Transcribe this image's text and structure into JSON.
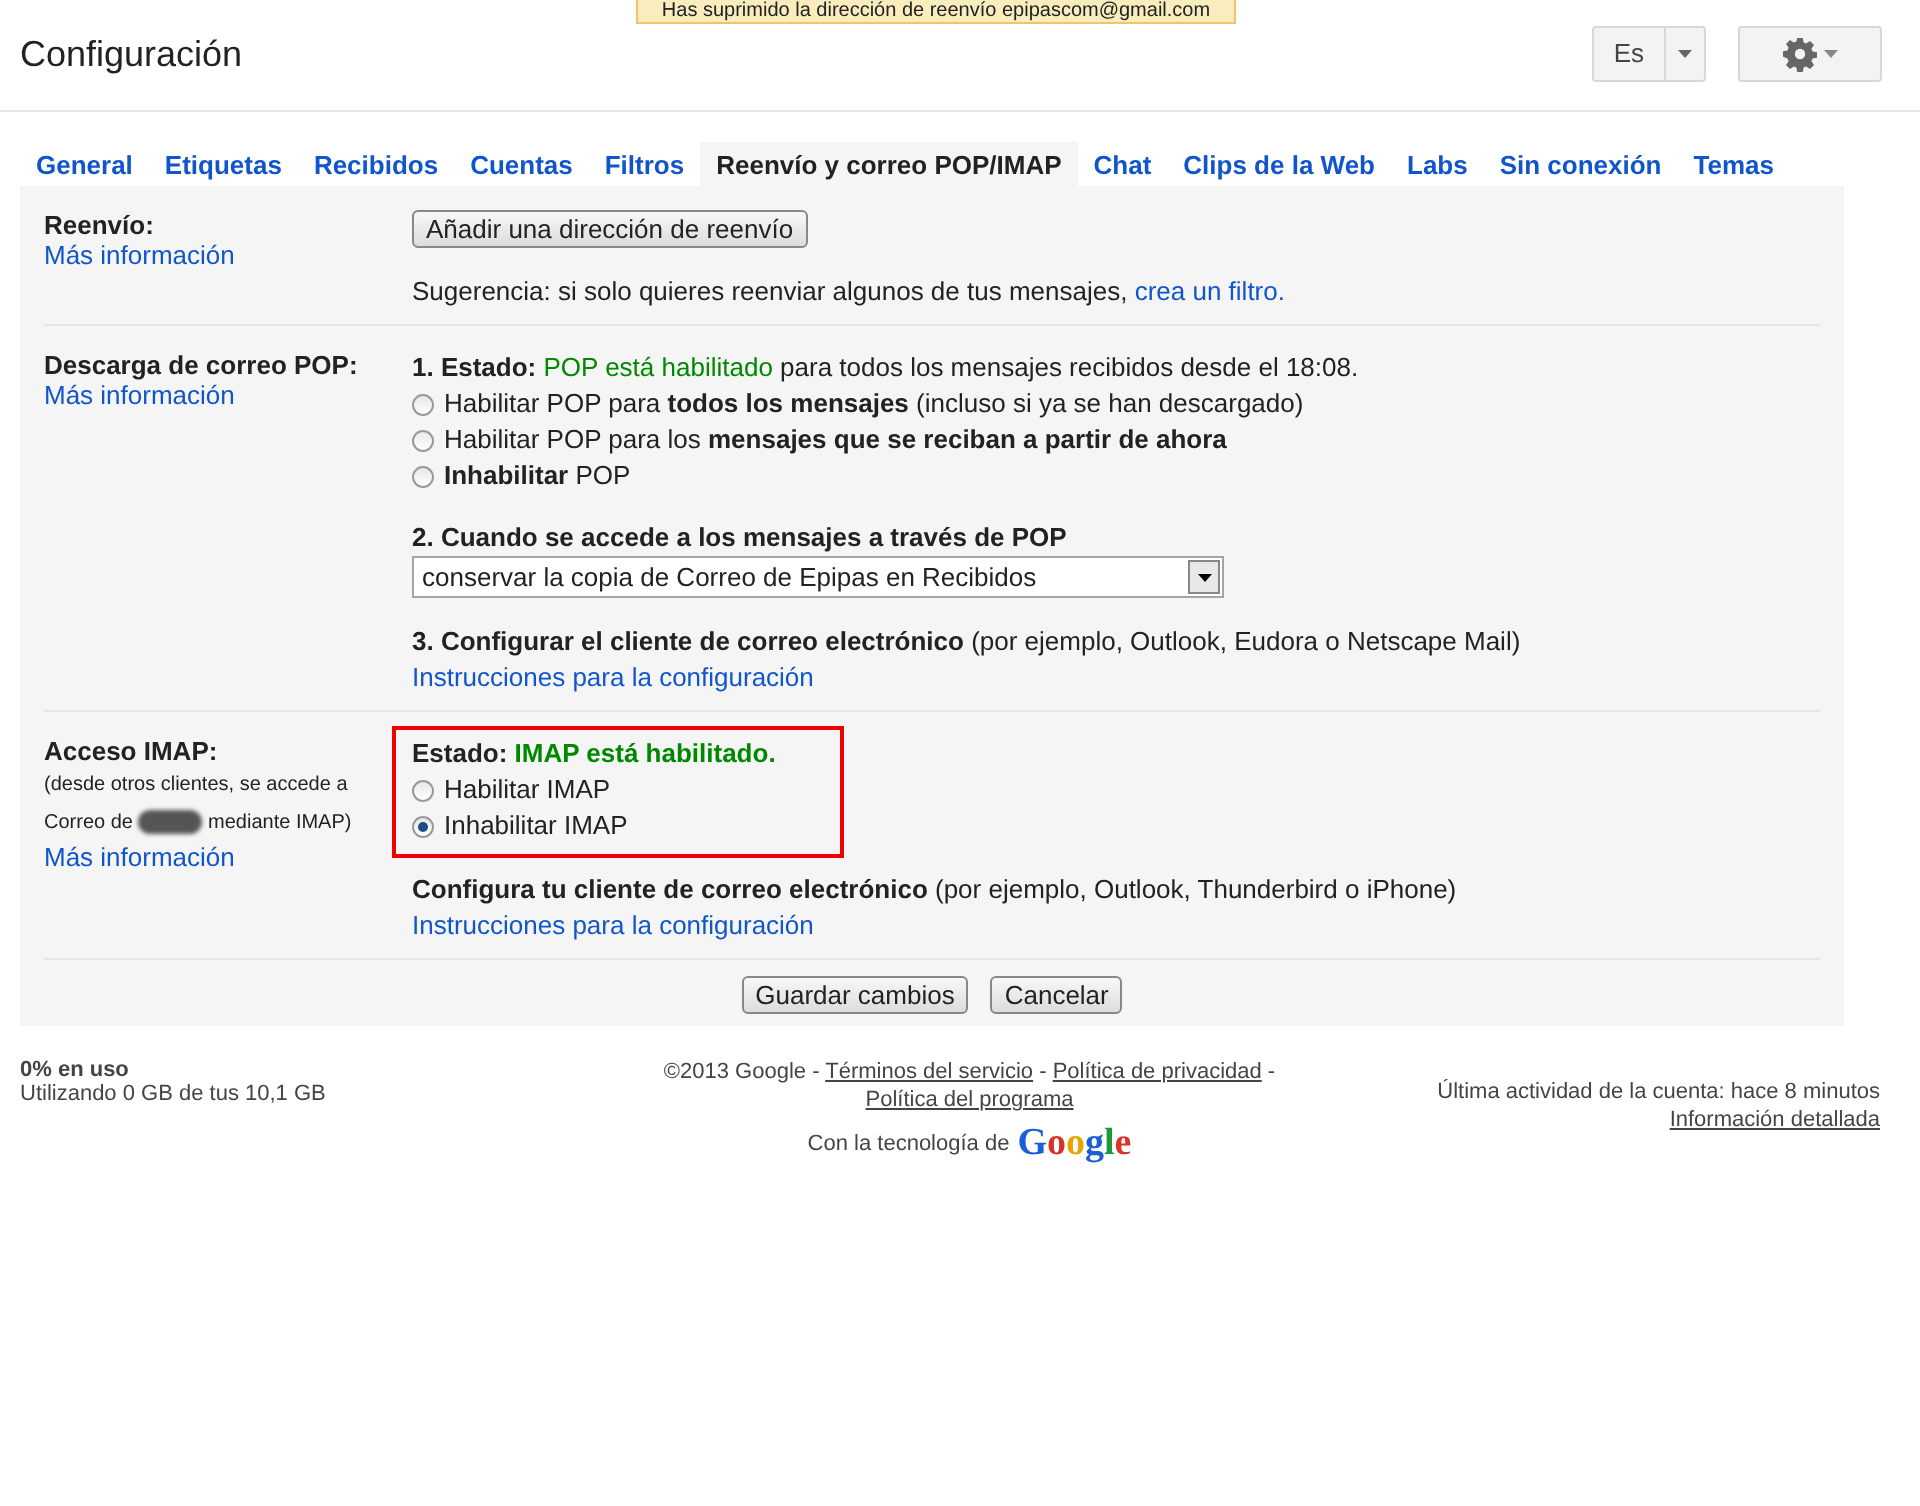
{
  "notice": {
    "text": "Has suprimido la dirección de reenvío epipascom@gmail.com"
  },
  "header": {
    "title": "Configuración",
    "language": "Es"
  },
  "tabs": [
    {
      "label": "General",
      "selected": false
    },
    {
      "label": "Etiquetas",
      "selected": false
    },
    {
      "label": "Recibidos",
      "selected": false
    },
    {
      "label": "Cuentas",
      "selected": false
    },
    {
      "label": "Filtros",
      "selected": false
    },
    {
      "label": "Reenvío y correo POP/IMAP",
      "selected": true
    },
    {
      "label": "Chat",
      "selected": false
    },
    {
      "label": "Clips de la Web",
      "selected": false
    },
    {
      "label": "Labs",
      "selected": false
    },
    {
      "label": "Sin conexión",
      "selected": false
    },
    {
      "label": "Temas",
      "selected": false
    }
  ],
  "sections": [
    {
      "label": "Reenvío:",
      "more": "Más información",
      "blocks": [
        {
          "highlighted": false,
          "lines": [
            {
              "kind": "button",
              "text": "Añadir una dirección de reenvío"
            }
          ]
        },
        {
          "highlighted": false,
          "lines": [
            {
              "kind": "text",
              "segments": [
                {
                  "kind": "plain",
                  "text": "Sugerencia: si solo quieres reenviar algunos de tus mensajes, "
                },
                {
                  "kind": "link",
                  "text": "crea un filtro."
                }
              ]
            }
          ]
        }
      ]
    },
    {
      "label": "Descarga de correo POP:",
      "more": "Más información",
      "blocks": [
        {
          "highlighted": false,
          "lines": [
            {
              "kind": "text",
              "segments": [
                {
                  "kind": "bold",
                  "text": "1. Estado: "
                },
                {
                  "kind": "good",
                  "text": "POP está habilitado"
                },
                {
                  "kind": "plain",
                  "text": " para todos los mensajes recibidos desde el 18:08."
                }
              ]
            },
            {
              "kind": "radio",
              "selected": false,
              "segments": [
                {
                  "kind": "plain",
                  "text": "Habilitar POP para "
                },
                {
                  "kind": "bold",
                  "text": "todos los mensajes"
                },
                {
                  "kind": "plain",
                  "text": " (incluso si ya se han descargado)"
                }
              ]
            },
            {
              "kind": "radio",
              "selected": false,
              "segments": [
                {
                  "kind": "plain",
                  "text": "Habilitar POP para los "
                },
                {
                  "kind": "bold",
                  "text": "mensajes que se reciban a partir de ahora"
                }
              ]
            },
            {
              "kind": "radio",
              "selected": false,
              "segments": [
                {
                  "kind": "bold",
                  "text": "Inhabilitar"
                },
                {
                  "kind": "plain",
                  "text": " POP"
                }
              ]
            }
          ]
        },
        {
          "highlighted": false,
          "lines": [
            {
              "kind": "text",
              "segments": [
                {
                  "kind": "bold",
                  "text": "2. Cuando se accede a los mensajes a través de POP"
                }
              ]
            },
            {
              "kind": "select",
              "text": "conservar la copia de Correo de Epipas en Recibidos"
            }
          ]
        },
        {
          "highlighted": false,
          "lines": [
            {
              "kind": "text",
              "segments": [
                {
                  "kind": "bold",
                  "text": "3. Configurar el cliente de correo electrónico"
                },
                {
                  "kind": "plain",
                  "text": " (por ejemplo, Outlook, Eudora o Netscape Mail)"
                }
              ]
            },
            {
              "kind": "link",
              "text": "Instrucciones para la configuración"
            }
          ]
        }
      ]
    },
    {
      "label": "Acceso IMAP:",
      "note_before": "(desde otros clientes, se accede a Correo de",
      "note_after": "mediante IMAP)",
      "more": "Más información",
      "blocks": [
        {
          "highlighted": true,
          "lines": [
            {
              "kind": "text",
              "segments": [
                {
                  "kind": "bold",
                  "text": "Estado: "
                },
                {
                  "kind": "goodbold",
                  "text": "IMAP está habilitado."
                }
              ]
            },
            {
              "kind": "radio",
              "selected": false,
              "segments": [
                {
                  "kind": "plain",
                  "text": "Habilitar IMAP"
                }
              ]
            },
            {
              "kind": "radio",
              "selected": true,
              "segments": [
                {
                  "kind": "plain",
                  "text": "Inhabilitar IMAP"
                }
              ]
            }
          ]
        },
        {
          "highlighted": false,
          "lines": [
            {
              "kind": "text",
              "segments": [
                {
                  "kind": "bold",
                  "text": "Configura tu cliente de correo electrónico"
                },
                {
                  "kind": "plain",
                  "text": " (por ejemplo, Outlook, Thunderbird o iPhone)"
                }
              ]
            },
            {
              "kind": "link",
              "text": "Instrucciones para la configuración"
            }
          ]
        }
      ]
    }
  ],
  "actions": [
    "Guardar cambios",
    "Cancelar"
  ],
  "footer": {
    "usage": "0% en uso",
    "quota": "Utilizando 0 GB de tus 10,1 GB",
    "legal": [
      {
        "kind": "text",
        "text": "©2013 Google - "
      },
      {
        "kind": "link",
        "text": "Términos del servicio"
      },
      {
        "kind": "text",
        "text": " - "
      },
      {
        "kind": "link",
        "text": "Política de privacidad"
      },
      {
        "kind": "text",
        "text": " -"
      },
      {
        "kind": "break"
      },
      {
        "kind": "link",
        "text": "Política del programa"
      }
    ],
    "powered": "Con la tecnología de",
    "logo": "Google",
    "activity": "Última actividad de la cuenta: hace 8 minutos",
    "details": "Información detallada"
  }
}
